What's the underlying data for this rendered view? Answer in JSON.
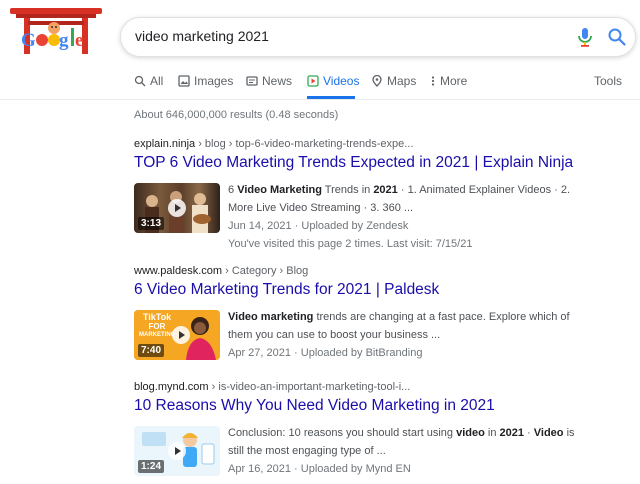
{
  "search": {
    "query": "video marketing 2021"
  },
  "tabs": [
    {
      "label": "All",
      "icon": "search-icon"
    },
    {
      "label": "Images",
      "icon": "image-icon"
    },
    {
      "label": "News",
      "icon": "news-icon"
    },
    {
      "label": "Videos",
      "icon": "video-icon",
      "active": true
    },
    {
      "label": "Maps",
      "icon": "map-pin-icon"
    },
    {
      "label": "More",
      "icon": "more-vert-icon"
    }
  ],
  "tools_label": "Tools",
  "stats": "About 646,000,000 results (0.48 seconds)",
  "results": [
    {
      "site": "explain.ninja",
      "path": " › blog › top-6-video-marketing-trends-expe...",
      "title": "TOP 6 Video Marketing Trends Expected in 2021 | Explain Ninja",
      "duration": "3:13",
      "snippet_parts": [
        "6 ",
        "Video Marketing",
        " Trends in ",
        "2021",
        " · 1. Animated Explainer Videos · 2. More Live Video Streaming · 3. 360 ..."
      ],
      "meta": "Jun 14, 2021 · Uploaded by Zendesk",
      "visited": "You've visited this page 2 times. Last visit: 7/15/21"
    },
    {
      "site": "www.paldesk.com",
      "path": " › Category › Blog",
      "title": "6 Video Marketing Trends for 2021 | Paldesk",
      "duration": "7:40",
      "thumb_text": [
        "TikTok",
        "FOR",
        "MARKETING"
      ],
      "snippet_parts": [
        "Video marketing",
        " trends are changing at a fast pace. Explore which of them you can use to boost your business ..."
      ],
      "meta": "Apr 27, 2021 · Uploaded by BitBranding"
    },
    {
      "site": "blog.mynd.com",
      "path": " › is-video-an-important-marketing-tool-i...",
      "title": "10 Reasons Why You Need Video Marketing in 2021",
      "duration": "1:24",
      "snippet_parts": [
        "Conclusion: 10 reasons you should start using ",
        "video",
        " in ",
        "2021",
        " · ",
        "Video",
        " is still the most engaging type of ..."
      ],
      "meta": "Apr 16, 2021 · Uploaded by Mynd EN"
    }
  ],
  "colors": {
    "link": "#1a0dab",
    "accent": "#1a73e8"
  }
}
